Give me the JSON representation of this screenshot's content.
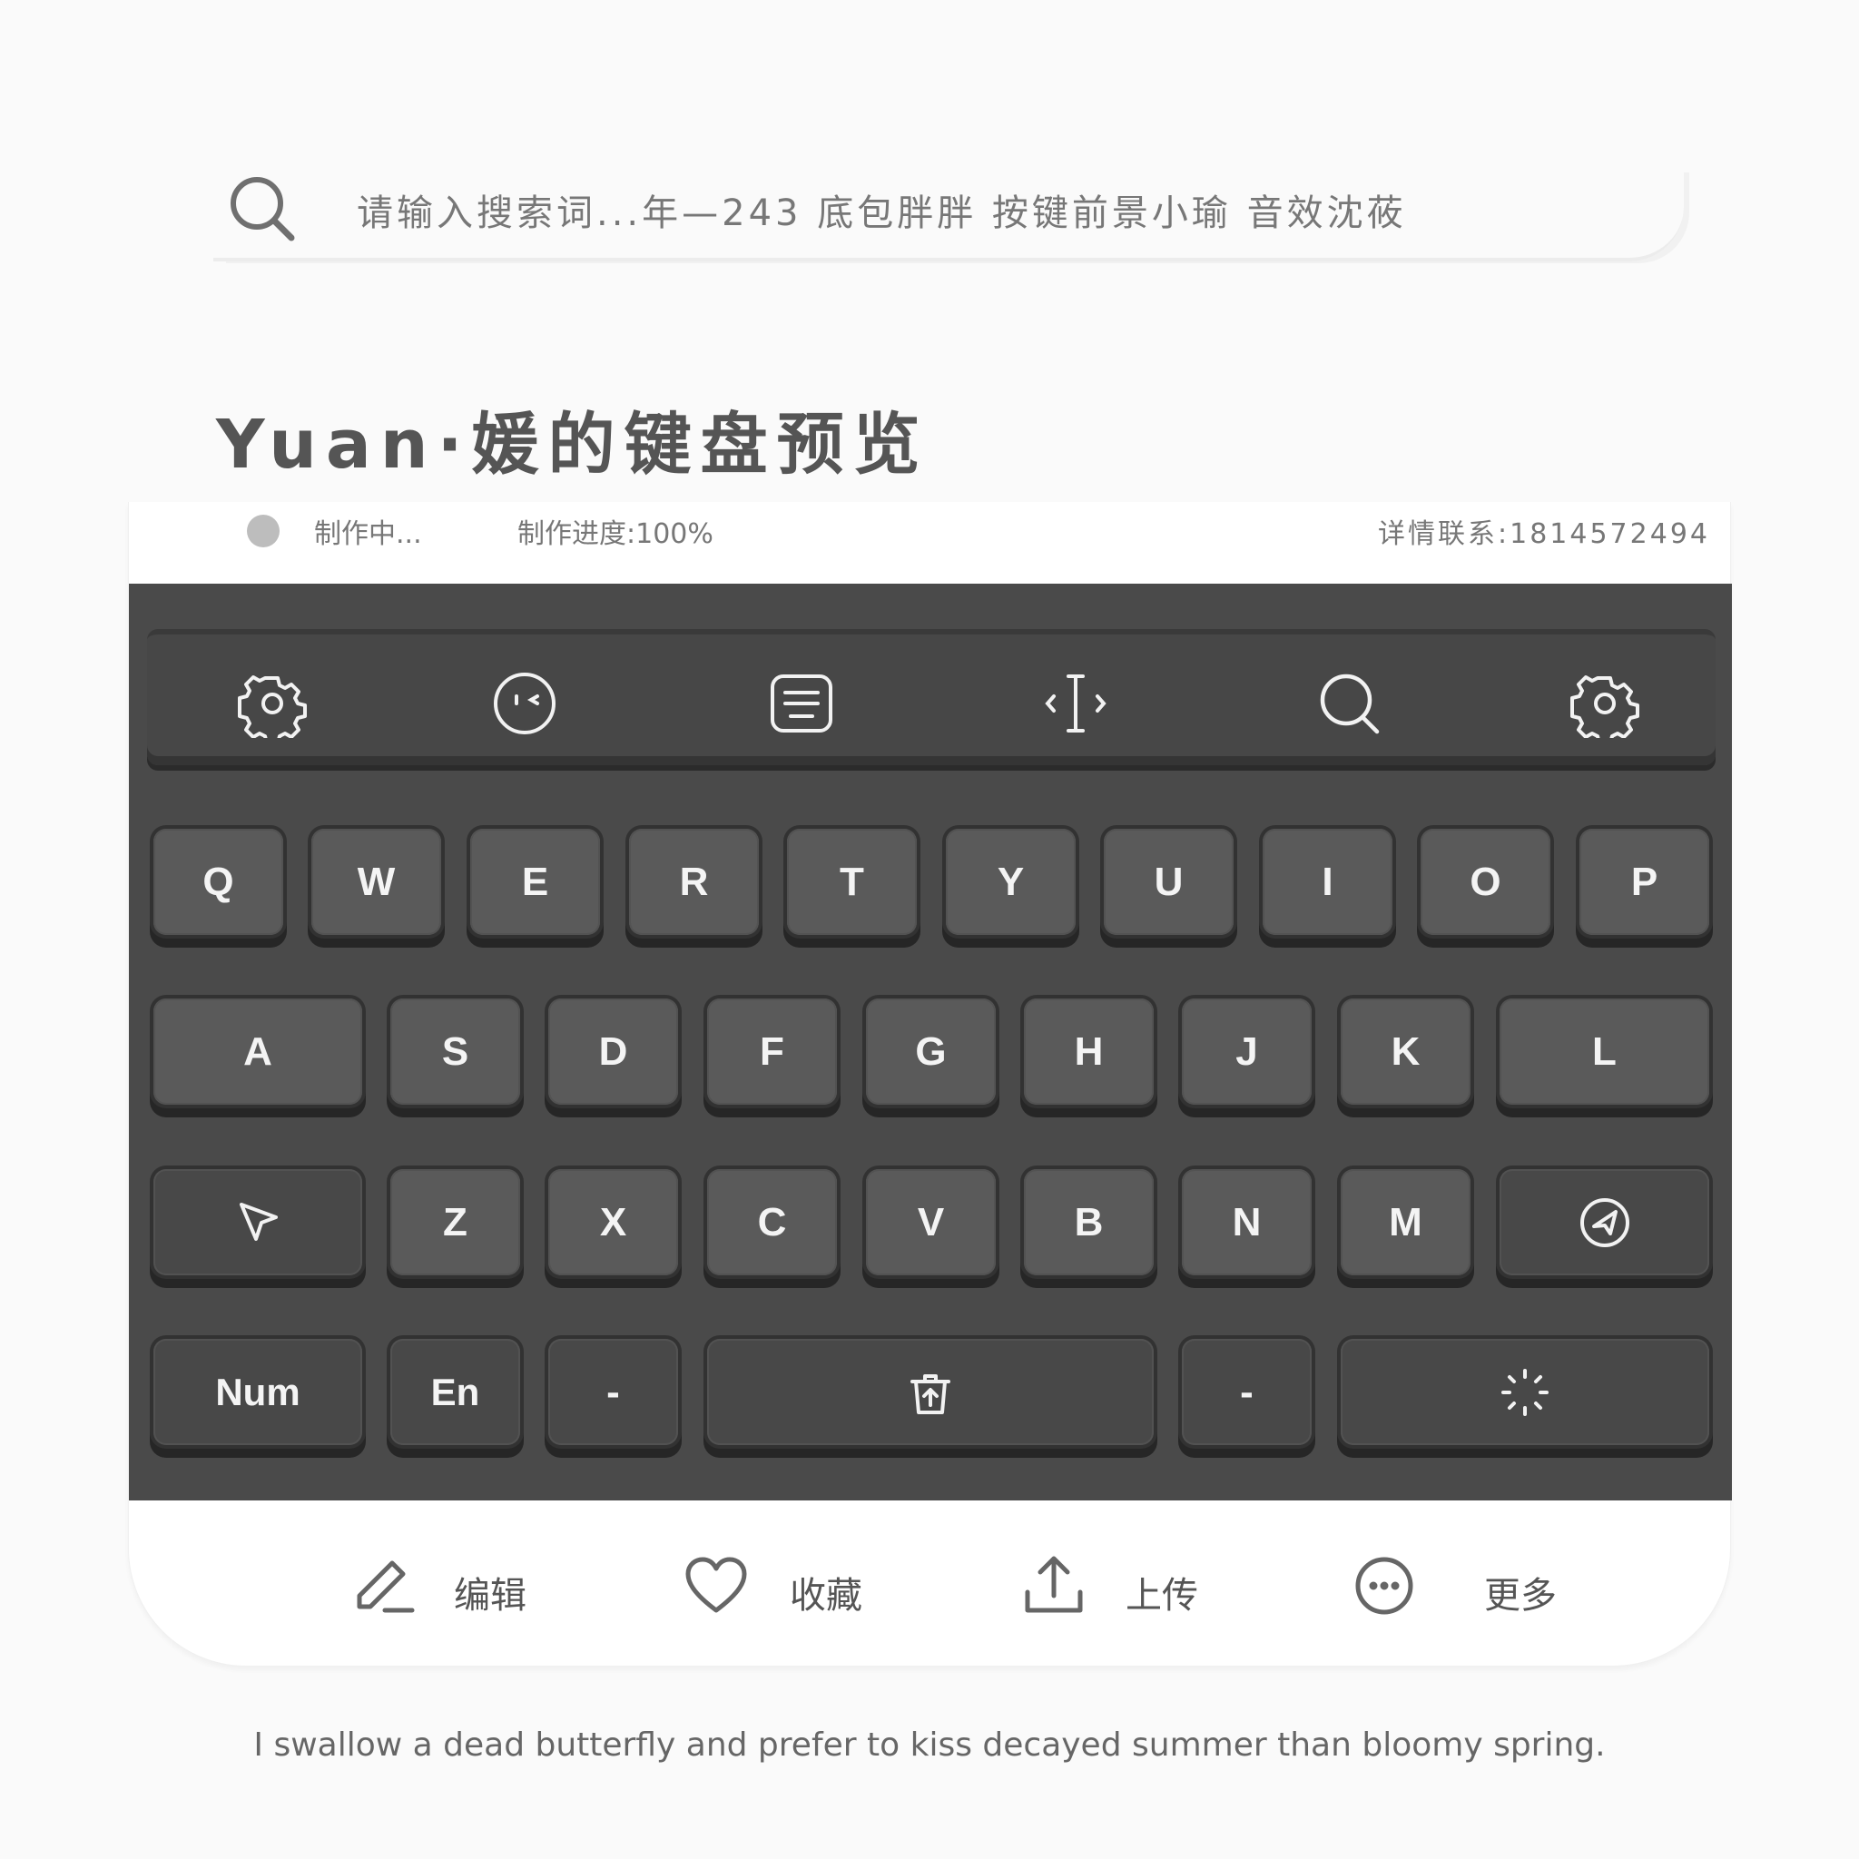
{
  "search": {
    "placeholder": "请输入搜索词...年—243  底包胖胖  按键前景小瑜  音效沈莜",
    "icon": "search-icon"
  },
  "title": "Yuan·媛的键盘预览",
  "status": {
    "making": "制作中...",
    "progress": "制作进度:100%",
    "contact": "详情联系:1814572494"
  },
  "toolbar": {
    "icons": [
      "gear-icon",
      "face-icon",
      "keyboard-icon",
      "cursor-icon",
      "search-icon",
      "gear-icon"
    ]
  },
  "keyboard": {
    "row1": [
      "Q",
      "W",
      "E",
      "R",
      "T",
      "Y",
      "U",
      "I",
      "O",
      "P"
    ],
    "row2": [
      "A",
      "S",
      "D",
      "F",
      "G",
      "H",
      "J",
      "K",
      "L"
    ],
    "row3": [
      "Z",
      "X",
      "C",
      "V",
      "B",
      "N",
      "M"
    ],
    "num": "Num",
    "en": "En",
    "dash1": "-",
    "dash2": "-",
    "colors": {
      "base": "#4a4a4a",
      "key": "#5a5a5a",
      "key_dark": "#484848",
      "legend": "#f4f4f4"
    }
  },
  "actions": {
    "edit": "编辑",
    "favorite": "收藏",
    "upload": "上传",
    "more": "更多"
  },
  "quote": "I swallow a dead butterfly and prefer to kiss decayed summer than bloomy spring."
}
